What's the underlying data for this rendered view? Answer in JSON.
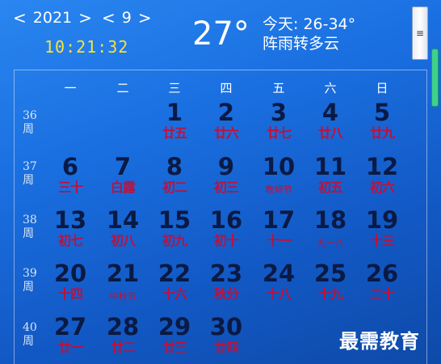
{
  "header": {
    "year_prev": "<",
    "year": "2021",
    "year_next": ">",
    "month_prev": "<",
    "month": "9",
    "month_next": ">",
    "time": "10:21:32",
    "temperature": "27°",
    "today_range": "今天: 26-34°",
    "condition": "阵雨转多云",
    "menu_icon": "≡"
  },
  "weekdays": [
    "一",
    "二",
    "三",
    "四",
    "五",
    "六",
    "日"
  ],
  "weeks": [
    {
      "num": "36",
      "label": "周"
    },
    {
      "num": "37",
      "label": "周"
    },
    {
      "num": "38",
      "label": "周"
    },
    {
      "num": "39",
      "label": "周"
    },
    {
      "num": "40",
      "label": "周"
    }
  ],
  "days": [
    {
      "day": "1",
      "lunar": "廿五"
    },
    {
      "day": "2",
      "lunar": "廿六"
    },
    {
      "day": "3",
      "lunar": "廿七"
    },
    {
      "day": "4",
      "lunar": "廿八"
    },
    {
      "day": "5",
      "lunar": "廿九"
    },
    {
      "day": "6",
      "lunar": "三十"
    },
    {
      "day": "7",
      "lunar": "白露"
    },
    {
      "day": "8",
      "lunar": "初二"
    },
    {
      "day": "9",
      "lunar": "初三"
    },
    {
      "day": "10",
      "lunar": "教师节",
      "small": true
    },
    {
      "day": "11",
      "lunar": "初五"
    },
    {
      "day": "12",
      "lunar": "初六"
    },
    {
      "day": "13",
      "lunar": "初七"
    },
    {
      "day": "14",
      "lunar": "初八"
    },
    {
      "day": "15",
      "lunar": "初九"
    },
    {
      "day": "16",
      "lunar": "初十"
    },
    {
      "day": "17",
      "lunar": "十一"
    },
    {
      "day": "18",
      "lunar": "九一八",
      "small": true
    },
    {
      "day": "19",
      "lunar": "十三"
    },
    {
      "day": "20",
      "lunar": "十四"
    },
    {
      "day": "21",
      "lunar": "中秋节",
      "small": true
    },
    {
      "day": "22",
      "lunar": "十六"
    },
    {
      "day": "23",
      "lunar": "秋分"
    },
    {
      "day": "24",
      "lunar": "十八"
    },
    {
      "day": "25",
      "lunar": "十九"
    },
    {
      "day": "26",
      "lunar": "二十"
    },
    {
      "day": "27",
      "lunar": "廿一"
    },
    {
      "day": "28",
      "lunar": "廿二"
    },
    {
      "day": "29",
      "lunar": "廿三"
    },
    {
      "day": "30",
      "lunar": "廿四"
    }
  ],
  "first_weekday_index": 2,
  "watermark": "最需教育",
  "colors": {
    "day_number": "#0a1a44",
    "lunar_text": "#c0103a",
    "time_text": "#f7e23c",
    "scroll_thumb": "#3fcf8e"
  }
}
